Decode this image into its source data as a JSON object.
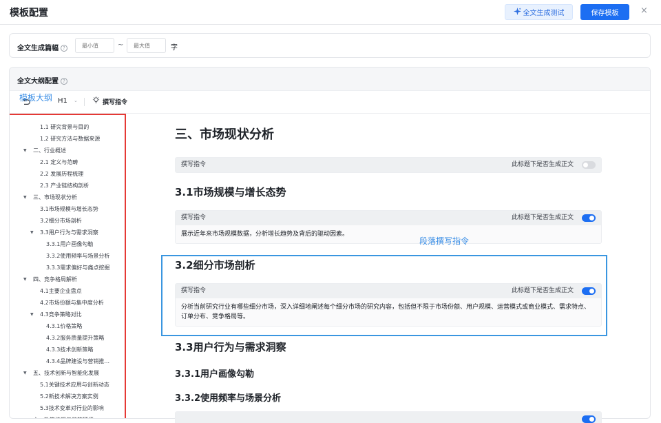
{
  "header": {
    "title": "模板配置",
    "test_button": "全文生成测试",
    "save_button": "保存模板",
    "close_symbol": "×"
  },
  "length": {
    "label": "全文生成篇幅",
    "min_placeholder": "最小值",
    "separator": "~",
    "max_placeholder": "最大值",
    "unit": "字"
  },
  "outline": {
    "label": "全文大纲配置",
    "annotation": "模板大纲",
    "heading_level": "H1",
    "write_command": "撰写指令"
  },
  "sidebar": {
    "items": [
      {
        "label": "1.1 研究背景与目的",
        "level": 2
      },
      {
        "label": "1.2 研究方法与数据来源",
        "level": 2
      },
      {
        "label": "二、行业概述",
        "level": 1,
        "expanded": true
      },
      {
        "label": "2.1 定义与范畴",
        "level": 2
      },
      {
        "label": "2.2 发展历程梳理",
        "level": 2
      },
      {
        "label": "2.3 产业链结构剖析",
        "level": 2
      },
      {
        "label": "三、市场现状分析",
        "level": 1,
        "expanded": true
      },
      {
        "label": "3.1市场规模与增长态势",
        "level": 2
      },
      {
        "label": "3.2细分市场剖析",
        "level": 2
      },
      {
        "label": "3.3用户行为与需求洞察",
        "level": 2,
        "expanded": true
      },
      {
        "label": "3.3.1用户画像勾勒",
        "level": 3
      },
      {
        "label": "3.3.2使用频率与场景分析",
        "level": 3
      },
      {
        "label": "3.3.3需求偏好与痛点挖掘",
        "level": 3
      },
      {
        "label": "四、竞争格局解析",
        "level": 1,
        "expanded": true
      },
      {
        "label": "4.1主要企业盘点",
        "level": 2
      },
      {
        "label": "4.2市场份额与集中度分析",
        "level": 2
      },
      {
        "label": "4.3竞争策略对比",
        "level": 2,
        "expanded": true
      },
      {
        "label": "4.3.1价格策略",
        "level": 3
      },
      {
        "label": "4.3.2服务质量提升策略",
        "level": 3
      },
      {
        "label": "4.3.3技术创新策略",
        "level": 3
      },
      {
        "label": "4.3.4品牌建设与营销推...",
        "level": 3
      },
      {
        "label": "五、技术创新与智能化发展",
        "level": 1,
        "expanded": true
      },
      {
        "label": "5.1关键技术应用与创新动态",
        "level": 2
      },
      {
        "label": "5.2新技术解决方案实例",
        "level": 2
      },
      {
        "label": "5.3技术变革对行业的影响",
        "level": 2
      },
      {
        "label": "六、政策法规与监管环境",
        "level": 1,
        "expanded": true
      }
    ]
  },
  "content": {
    "section3_title": "三、市场现状分析",
    "cmd_label": "撰写指令",
    "toggle_label": "此标题下是否生成正文",
    "s31_title": "3.1市场规模与增长态势",
    "s31_text": "展示近年来市场规模数据，分析增长趋势及背后的驱动因素。",
    "para_annotation": "段落撰写指令",
    "s32_title": "3.2细分市场剖析",
    "s32_text": "分析当前研究行业有哪些细分市场，深入详细地阐述每个细分市场的研究内容，包括但不限于市场份额、用户规模、运营模式或商业模式、需求特点、订单分布、竞争格局等。",
    "s33_title": "3.3用户行为与需求洞察",
    "s331_title": "3.3.1用户画像勾勒",
    "s332_title": "3.3.2使用频率与场景分析",
    "toggles": {
      "s3": false,
      "s31": true,
      "s32": true,
      "s332": true
    }
  },
  "colors": {
    "primary": "#1c6ef2",
    "highlight_red": "#e53935",
    "highlight_blue": "#3a96e0",
    "annotation_blue": "#3a8ee6"
  }
}
